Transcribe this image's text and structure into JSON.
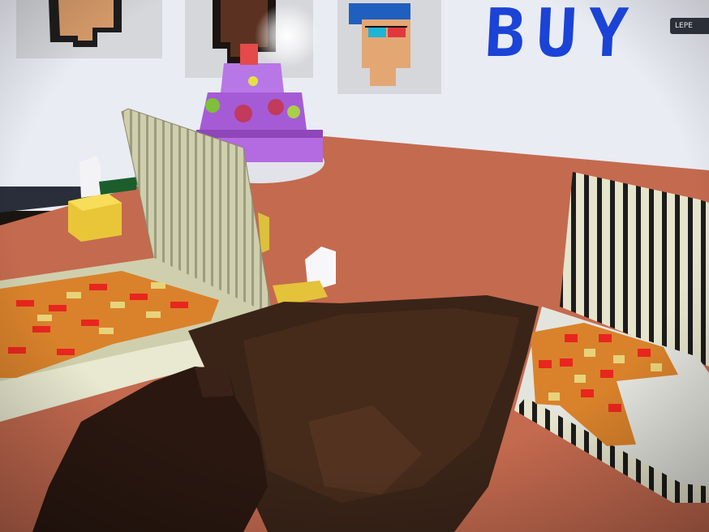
{
  "scene": {
    "sign_text": "BUY",
    "corner_tag": "LEPE"
  },
  "colors": {
    "table": "#c46a4f",
    "wall": "#e9ecf3",
    "sign_blue": "#1b43d6",
    "cake_purple": "#b46ae0",
    "pizza_crust": "#d9822b",
    "pepperoni": "#e8261f",
    "cheese": "#e7d37a"
  },
  "icons": [
    "portrait-1",
    "portrait-2",
    "portrait-3d-glasses",
    "glare-light"
  ]
}
